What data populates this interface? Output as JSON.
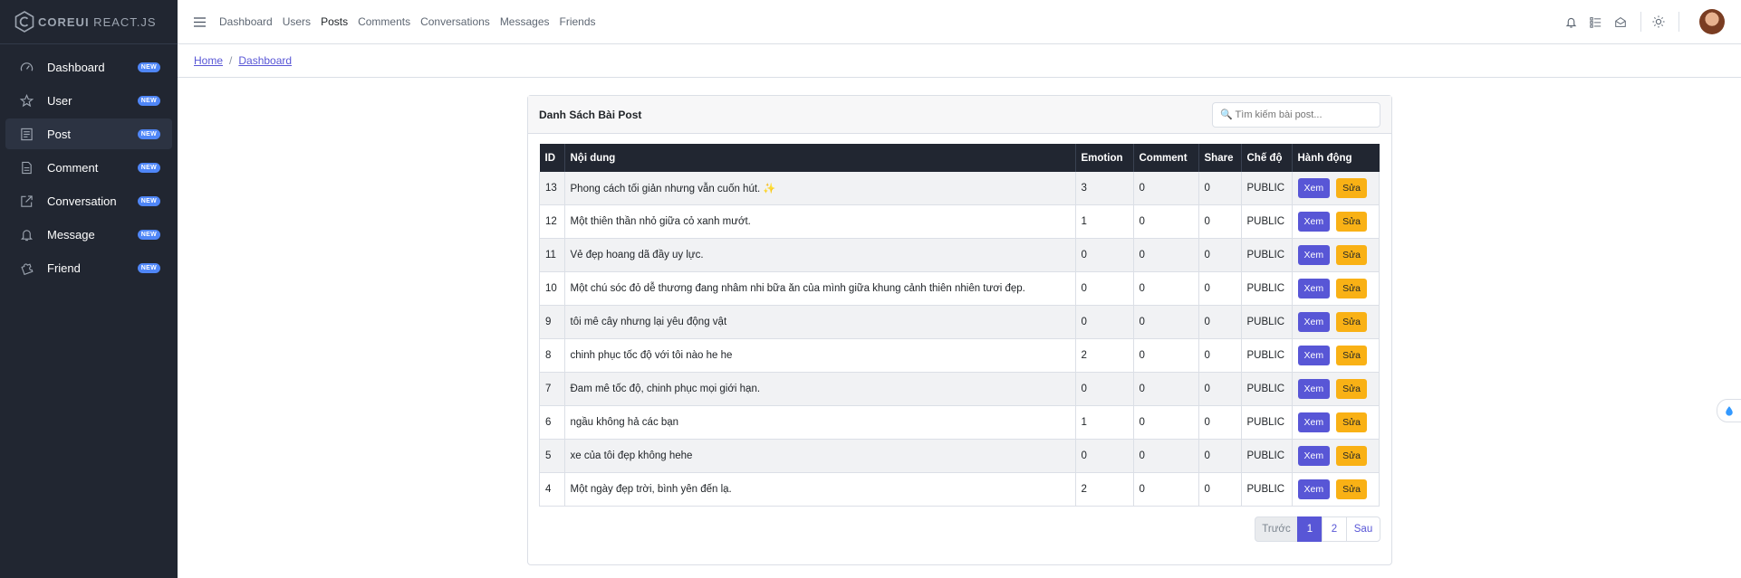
{
  "brand": {
    "part1": "COREUI",
    "part2": " REACT.JS"
  },
  "sidebar": {
    "items": [
      {
        "label": "Dashboard",
        "badge": "NEW"
      },
      {
        "label": "User",
        "badge": "NEW"
      },
      {
        "label": "Post",
        "badge": "NEW"
      },
      {
        "label": "Comment",
        "badge": "NEW"
      },
      {
        "label": "Conversation",
        "badge": "NEW"
      },
      {
        "label": "Message",
        "badge": "NEW"
      },
      {
        "label": "Friend",
        "badge": "NEW"
      }
    ]
  },
  "header": {
    "nav": [
      "Dashboard",
      "Users",
      "Posts",
      "Comments",
      "Conversations",
      "Messages",
      "Friends"
    ]
  },
  "breadcrumb": {
    "home": "Home",
    "current": "Dashboard"
  },
  "card": {
    "title": "Danh Sách Bài Post",
    "search_placeholder": "🔍 Tìm kiếm bài post..."
  },
  "table": {
    "headers": [
      "ID",
      "Nội dung",
      "Emotion",
      "Comment",
      "Share",
      "Chế độ",
      "Hành động"
    ],
    "view_label": "Xem",
    "edit_label": "Sửa",
    "rows": [
      {
        "id": "13",
        "content": "Phong cách tối giản nhưng vẫn cuốn hút. ✨",
        "emotion": "3",
        "comment": "0",
        "share": "0",
        "mode": "PUBLIC"
      },
      {
        "id": "12",
        "content": "Một thiên thần nhỏ giữa cỏ xanh mướt.",
        "emotion": "1",
        "comment": "0",
        "share": "0",
        "mode": "PUBLIC"
      },
      {
        "id": "11",
        "content": "Vẻ đẹp hoang dã đầy uy lực.",
        "emotion": "0",
        "comment": "0",
        "share": "0",
        "mode": "PUBLIC"
      },
      {
        "id": "10",
        "content": "Một chú sóc đỏ dễ thương đang nhâm nhi bữa ăn của mình giữa khung cảnh thiên nhiên tươi đẹp.",
        "emotion": "0",
        "comment": "0",
        "share": "0",
        "mode": "PUBLIC"
      },
      {
        "id": "9",
        "content": "tôi mê cây nhưng lại yêu động vật",
        "emotion": "0",
        "comment": "0",
        "share": "0",
        "mode": "PUBLIC"
      },
      {
        "id": "8",
        "content": "chinh phục tốc độ với tôi nào he he",
        "emotion": "2",
        "comment": "0",
        "share": "0",
        "mode": "PUBLIC"
      },
      {
        "id": "7",
        "content": "Đam mê tốc độ, chinh phục mọi giới hạn.",
        "emotion": "0",
        "comment": "0",
        "share": "0",
        "mode": "PUBLIC"
      },
      {
        "id": "6",
        "content": "ngầu không hả các bạn",
        "emotion": "1",
        "comment": "0",
        "share": "0",
        "mode": "PUBLIC"
      },
      {
        "id": "5",
        "content": "xe của tôi đẹp không hehe",
        "emotion": "0",
        "comment": "0",
        "share": "0",
        "mode": "PUBLIC"
      },
      {
        "id": "4",
        "content": "Một ngày đẹp trời, bình yên đến lạ.",
        "emotion": "2",
        "comment": "0",
        "share": "0",
        "mode": "PUBLIC"
      }
    ]
  },
  "pagination": {
    "prev": "Trước",
    "pages": [
      "1",
      "2"
    ],
    "next": "Sau",
    "current": "1"
  },
  "colors": {
    "sidebar_bg": "#212631",
    "primary": "#5856d6",
    "warning": "#f9b115",
    "badge": "#4f86f7"
  }
}
